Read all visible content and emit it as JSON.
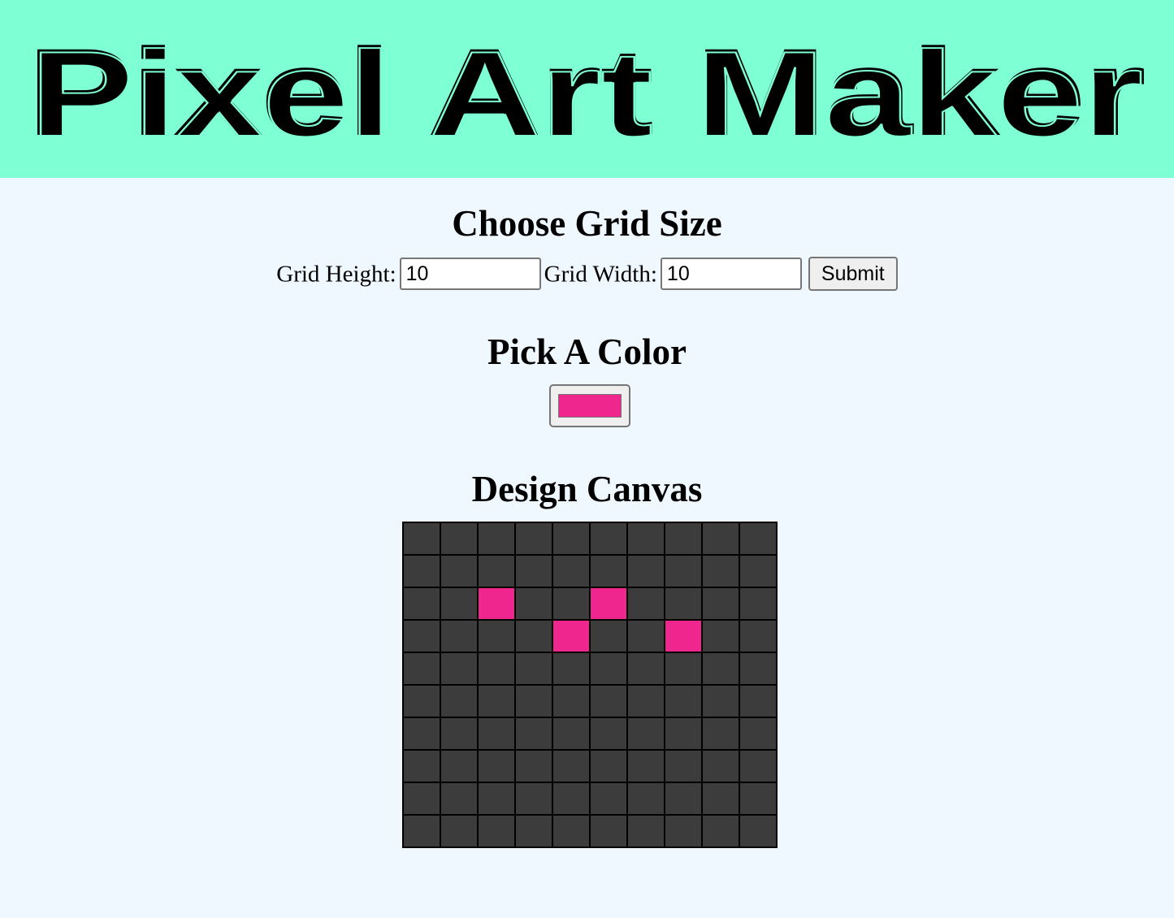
{
  "header": {
    "title": "Pixel Art Maker",
    "background": "#7fffd4"
  },
  "grid_size": {
    "heading": "Choose Grid Size",
    "height_label": "Grid Height:",
    "height_value": "10",
    "width_label": "Grid Width:",
    "width_value": "10",
    "submit_label": "Submit"
  },
  "color": {
    "heading": "Pick A Color",
    "selected": "#f0268f"
  },
  "canvas": {
    "heading": "Design Canvas",
    "rows": 10,
    "cols": 10,
    "empty_color": "#3c3c3c",
    "filled_cells": [
      [
        2,
        2
      ],
      [
        2,
        5
      ],
      [
        3,
        4
      ],
      [
        3,
        7
      ]
    ]
  }
}
